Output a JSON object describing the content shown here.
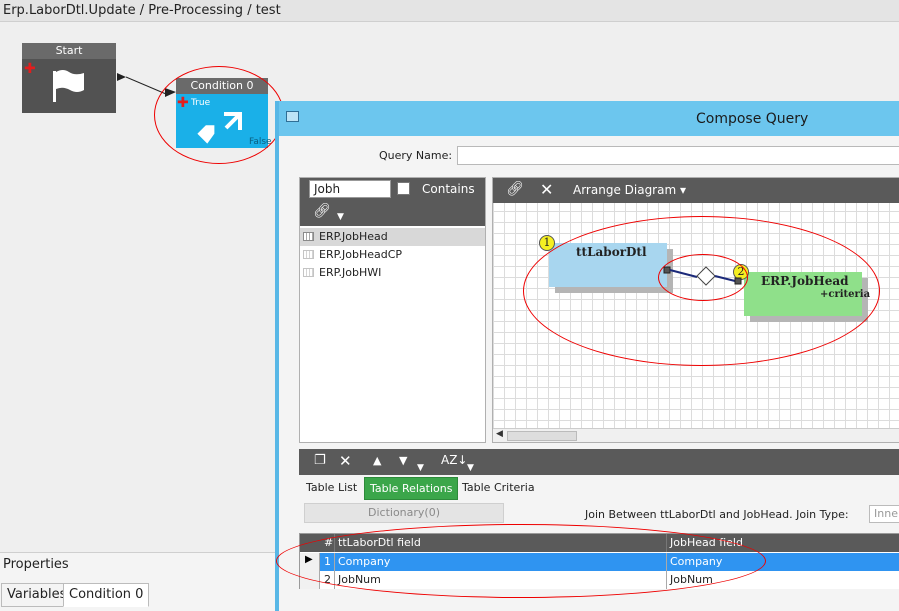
{
  "window": {
    "title": "Erp.LaborDtl.Update / Pre-Processing / test"
  },
  "workflow": {
    "start_node": {
      "label": "Start"
    },
    "condition_node": {
      "label": "Condition 0",
      "true_label": "True",
      "false_label": "False"
    }
  },
  "properties": {
    "title": "Properties",
    "tabs": [
      "Variables",
      "Condition 0"
    ]
  },
  "dialog": {
    "title": "Compose Query",
    "query_name_label": "Query Name:",
    "query_name_value": "",
    "search": {
      "value": "Jobh",
      "contains_label": "Contains",
      "contains_checked": false
    },
    "tables": [
      {
        "name": "ERP.JobHead",
        "selected": true
      },
      {
        "name": "ERP.JobHeadCP",
        "selected": false
      },
      {
        "name": "ERP.JobHWI",
        "selected": false
      }
    ],
    "diagram": {
      "arrange_label": "Arrange Diagram",
      "table1": {
        "badge": "1",
        "name": "ttLaborDtl"
      },
      "table2": {
        "badge": "2",
        "name": "ERP.JobHead",
        "sub": "+criteria"
      }
    },
    "tabs": [
      "Table List",
      "Table Relations",
      "Table Criteria"
    ],
    "active_tab": "Table Relations",
    "dictionary_button": "Dictionary(0)",
    "join_text": "Join Between ttLaborDtl and JobHead.",
    "join_type_label": "Join Type:",
    "join_type_value": "Inner",
    "grid": {
      "columns": [
        "#",
        "ttLaborDtl field",
        "JobHead field"
      ],
      "rows": [
        {
          "num": "1",
          "left": "Company",
          "right": "Company",
          "selected": true
        },
        {
          "num": "2",
          "left": "JobNum",
          "right": "JobNum",
          "selected": false
        }
      ]
    }
  },
  "colors": {
    "dialog_title": "#6cc6ee",
    "condition_node": "#1ab0e8",
    "tab_active": "#3ba64a",
    "row_selected": "#2f94f1",
    "table1_fill": "#a8d6ef",
    "table2_fill": "#8fe08a",
    "annotation": "#e00000"
  }
}
